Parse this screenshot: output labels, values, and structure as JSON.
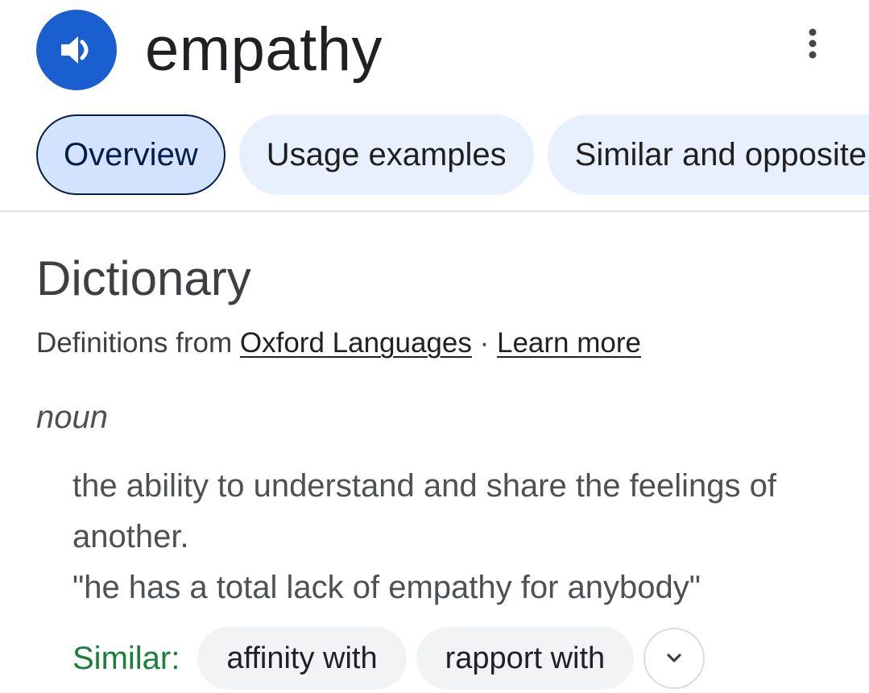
{
  "header": {
    "word": "empathy",
    "speaker_icon": "volume-up-icon",
    "more_icon": "more-vert-icon"
  },
  "tabs": [
    {
      "label": "Overview",
      "active": true
    },
    {
      "label": "Usage examples",
      "active": false
    },
    {
      "label": "Similar and opposite words",
      "active": false
    }
  ],
  "dictionary": {
    "title": "Dictionary",
    "source_prefix": "Definitions from",
    "source_link": "Oxford Languages",
    "separator": "·",
    "learn_more": "Learn more",
    "part_of_speech": "noun",
    "definition": "the ability to understand and share the feelings of another.",
    "example": "\"he has a total lack of empathy for anybody\"",
    "similar_label": "Similar:",
    "similar_words": [
      "affinity with",
      "rapport with"
    ],
    "expand_icon": "chevron-down-icon"
  },
  "colors": {
    "accent": "#1a5fd0",
    "tab_active_bg": "#d3e3fd",
    "tab_bg": "#e8f0fe",
    "similar_green": "#188038"
  }
}
